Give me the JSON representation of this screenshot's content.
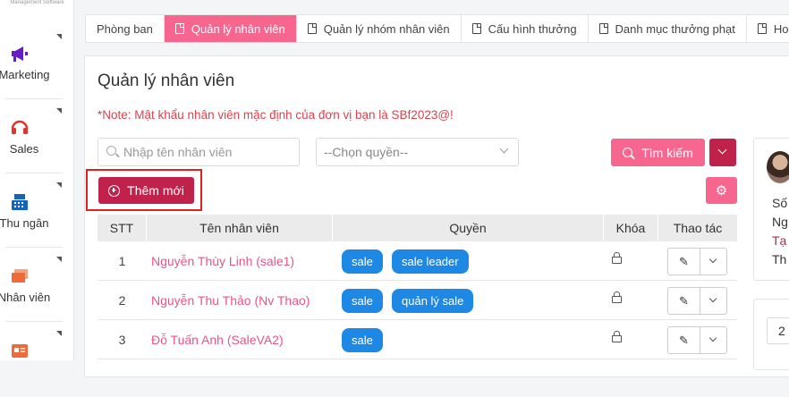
{
  "sidebar": {
    "top_text": "Management Software",
    "items": [
      {
        "label": "Marketing",
        "icon": "megaphone-icon",
        "color": "#6a1bc9"
      },
      {
        "label": "Sales",
        "icon": "headset-icon",
        "color": "#e5322d"
      },
      {
        "label": "Thu ngân",
        "icon": "cash-register-icon",
        "color": "#1565c0"
      },
      {
        "label": "Nhân viên",
        "icon": "cards-icon",
        "color": "#ef6c3a"
      },
      {
        "label": "",
        "icon": "id-card-icon",
        "color": "#ef6c3a"
      }
    ]
  },
  "tabs": [
    {
      "label": "Phòng ban",
      "active": false,
      "doc": false
    },
    {
      "label": "Quản lý nhân viên",
      "active": true,
      "doc": true
    },
    {
      "label": "Quản lý nhóm nhân viên",
      "active": false,
      "doc": true
    },
    {
      "label": "Cấu hình thưởng",
      "active": false,
      "doc": true
    },
    {
      "label": "Danh mục thưởng phạt",
      "active": false,
      "doc": true
    },
    {
      "label": "Hoa hồ",
      "active": false,
      "doc": true
    }
  ],
  "main": {
    "title": "Quản lý nhân viên",
    "note": "*Note: Mật khẩu nhân viên mặc định của đơn vị bạn là SBf2023@!",
    "search_placeholder": "Nhập tên nhân viên",
    "role_select": "--Chọn quyền--",
    "search_button": "Tìm kiếm",
    "add_button": "Thêm mới"
  },
  "table": {
    "headers": {
      "stt": "STT",
      "name": "Tên nhân viên",
      "role": "Quyền",
      "lock": "Khóa",
      "action": "Thao tác"
    },
    "rows": [
      {
        "stt": "1",
        "name": "Nguyễn Thùy Linh (sale1)",
        "roles": [
          "sale",
          "sale leader"
        ]
      },
      {
        "stt": "2",
        "name": "Nguyễn Thu Thảo (Nv Thao)",
        "roles": [
          "sale",
          "quản lý sale"
        ]
      },
      {
        "stt": "3",
        "name": "Đỗ Tuấn Anh (SaleVA2)",
        "roles": [
          "sale"
        ]
      }
    ]
  },
  "right_card": {
    "lines": [
      "Số",
      "Ng",
      "Tạ",
      "Th"
    ],
    "box_value": "2"
  },
  "colors": {
    "accent": "#f7668f",
    "primary_dark": "#c1224b",
    "badge": "#1e88e5",
    "name_link": "#e9548b",
    "note": "#d9434f"
  }
}
